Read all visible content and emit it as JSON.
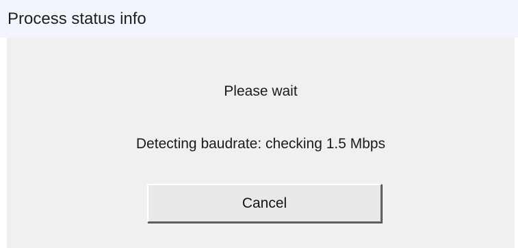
{
  "window": {
    "title": "Process status info"
  },
  "content": {
    "wait_message": "Please wait",
    "status_message": "Detecting baudrate: checking 1.5 Mbps"
  },
  "actions": {
    "cancel_label": "Cancel"
  },
  "colors": {
    "titlebar_bg": "#f2f6fc",
    "dialog_bg": "#f0f0f0",
    "button_bg": "#e9e9e9"
  }
}
